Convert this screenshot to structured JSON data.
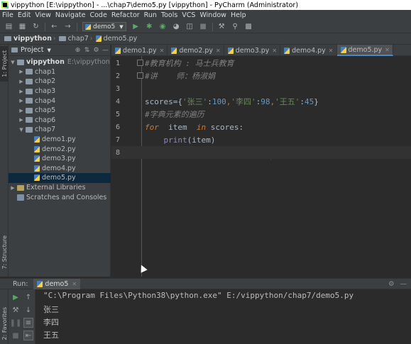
{
  "window": {
    "title": "vippython [E:\\vippython] - ...\\chap7\\demo5.py [vippython] - PyCharm (Administrator)"
  },
  "menu": [
    "File",
    "Edit",
    "View",
    "Navigate",
    "Code",
    "Refactor",
    "Run",
    "Tools",
    "VCS",
    "Window",
    "Help"
  ],
  "toolbar": {
    "run_config": "demo5",
    "icons": [
      "open-icon",
      "save-all-icon",
      "sync-icon",
      "back-icon",
      "forward-icon",
      "run-icon",
      "debug-icon",
      "coverage-icon",
      "profile-icon",
      "concurrency-icon",
      "stop-icon",
      "settings-wrench-icon",
      "search-icon",
      "structure-icon"
    ]
  },
  "breadcrumb": [
    "vippython",
    "chap7",
    "demo5.py"
  ],
  "left_strip": {
    "project_tab": "1: Project",
    "structure_tab": "7: Structure",
    "favorites_tab": "2: Favorites"
  },
  "project_panel": {
    "title": "Project",
    "tree": [
      {
        "label": "vippython",
        "path": "E:\\vippython",
        "kind": "folder",
        "level": 0,
        "arrow": "down"
      },
      {
        "label": "chap1",
        "kind": "folder",
        "level": 1,
        "arrow": "right"
      },
      {
        "label": "chap2",
        "kind": "folder",
        "level": 1,
        "arrow": "right"
      },
      {
        "label": "chap3",
        "kind": "folder",
        "level": 1,
        "arrow": "right"
      },
      {
        "label": "chap4",
        "kind": "folder",
        "level": 1,
        "arrow": "right"
      },
      {
        "label": "chap5",
        "kind": "folder",
        "level": 1,
        "arrow": "right"
      },
      {
        "label": "chap6",
        "kind": "folder",
        "level": 1,
        "arrow": "right"
      },
      {
        "label": "chap7",
        "kind": "folder",
        "level": 1,
        "arrow": "down"
      },
      {
        "label": "demo1.py",
        "kind": "py",
        "level": 2
      },
      {
        "label": "demo2.py",
        "kind": "py",
        "level": 2
      },
      {
        "label": "demo3.py",
        "kind": "py",
        "level": 2
      },
      {
        "label": "demo4.py",
        "kind": "py",
        "level": 2
      },
      {
        "label": "demo5.py",
        "kind": "py",
        "level": 2,
        "selected": true
      },
      {
        "label": "External Libraries",
        "kind": "lib",
        "level": 0,
        "arrow": "right"
      },
      {
        "label": "Scratches and Consoles",
        "kind": "scratch",
        "level": 0
      }
    ]
  },
  "editor_tabs": [
    {
      "label": "demo1.py",
      "active": false
    },
    {
      "label": "demo2.py",
      "active": false
    },
    {
      "label": "demo3.py",
      "active": false
    },
    {
      "label": "demo4.py",
      "active": false
    },
    {
      "label": "demo5.py",
      "active": true
    }
  ],
  "editor": {
    "current_line": 8,
    "lines": [
      {
        "n": "1",
        "tokens": [
          {
            "t": "#教育机构 : 马士兵教育",
            "c": "comment"
          }
        ]
      },
      {
        "n": "2",
        "tokens": [
          {
            "t": "#讲    师：杨淑娟",
            "c": "comment"
          }
        ]
      },
      {
        "n": "3",
        "tokens": []
      },
      {
        "n": "4",
        "tokens": [
          {
            "t": "scores",
            "c": "name"
          },
          {
            "t": "=",
            "c": "name"
          },
          {
            "t": "{",
            "c": "name"
          },
          {
            "t": "'张三'",
            "c": "str"
          },
          {
            "t": ":",
            "c": "name"
          },
          {
            "t": "100",
            "c": "num"
          },
          {
            "t": ",",
            "c": "op"
          },
          {
            "t": "'李四'",
            "c": "str"
          },
          {
            "t": ":",
            "c": "name"
          },
          {
            "t": "98",
            "c": "num"
          },
          {
            "t": ",",
            "c": "op"
          },
          {
            "t": "'王五'",
            "c": "str"
          },
          {
            "t": ":",
            "c": "name"
          },
          {
            "t": "45",
            "c": "num"
          },
          {
            "t": "}",
            "c": "name"
          }
        ]
      },
      {
        "n": "5",
        "tokens": [
          {
            "t": "#字典元素的遍历",
            "c": "comment"
          }
        ]
      },
      {
        "n": "6",
        "tokens": [
          {
            "t": "for",
            "c": "kw"
          },
          {
            "t": "  item  ",
            "c": "name"
          },
          {
            "t": "in",
            "c": "kw"
          },
          {
            "t": " scores",
            "c": "name"
          },
          {
            "t": ":",
            "c": "name"
          }
        ]
      },
      {
        "n": "7",
        "tokens": [
          {
            "t": "    ",
            "c": "name"
          },
          {
            "t": "print",
            "c": "builtin"
          },
          {
            "t": "(item)",
            "c": "name"
          }
        ]
      },
      {
        "n": "8",
        "tokens": []
      }
    ]
  },
  "run_panel": {
    "label": "Run:",
    "tab": "demo5",
    "output": [
      "\"C:\\Program Files\\Python38\\python.exe\" E:/vippython/chap7/demo5.py",
      "张三",
      "李四",
      "王五"
    ]
  },
  "colors": {
    "editor_bg": "#2b2b2b",
    "panel_bg": "#3c3f41",
    "selection": "#0d293e",
    "comment": "#808080",
    "string": "#6a8759",
    "number": "#6897bb",
    "keyword": "#cc7832",
    "builtin": "#8888c6"
  }
}
